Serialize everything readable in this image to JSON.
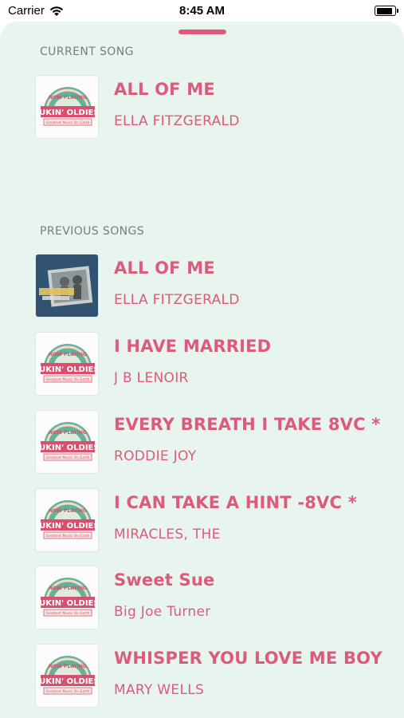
{
  "status_bar": {
    "carrier": "Carrier",
    "time": "8:45 AM",
    "wifi_icon": "wifi-icon",
    "battery_icon": "battery-icon"
  },
  "current": {
    "label": "CURRENT SONG",
    "song": {
      "title": "ALL OF ME",
      "artist": "ELLA FITZGERALD",
      "art": "jukin-oldies-logo",
      "logo_top": "NOW PLAYING",
      "logo_main": "JUKIN' OLDIES",
      "logo_bottom": "Greatest Music On Earth"
    }
  },
  "previous": {
    "label": "PREVIOUS SONGS",
    "songs": [
      {
        "title": "ALL OF ME",
        "artist": "ELLA FITZGERALD",
        "art": "album-photo"
      },
      {
        "title": "I HAVE MARRIED",
        "artist": "J B LENOIR",
        "art": "jukin-oldies-logo"
      },
      {
        "title": "EVERY BREATH I TAKE  8VC *",
        "artist": "RODDIE JOY",
        "art": "jukin-oldies-logo"
      },
      {
        "title": "I CAN TAKE A HINT -8VC *",
        "artist": "MIRACLES, THE",
        "art": "jukin-oldies-logo"
      },
      {
        "title": "Sweet Sue",
        "artist": "Big Joe Turner",
        "art": "jukin-oldies-logo"
      },
      {
        "title": "WHISPER YOU LOVE ME BOY",
        "artist": "MARY WELLS",
        "art": "jukin-oldies-logo"
      }
    ]
  },
  "colors": {
    "accent": "#dd5a7e",
    "background": "#e7f5ee",
    "label_gray": "#787d7a"
  }
}
